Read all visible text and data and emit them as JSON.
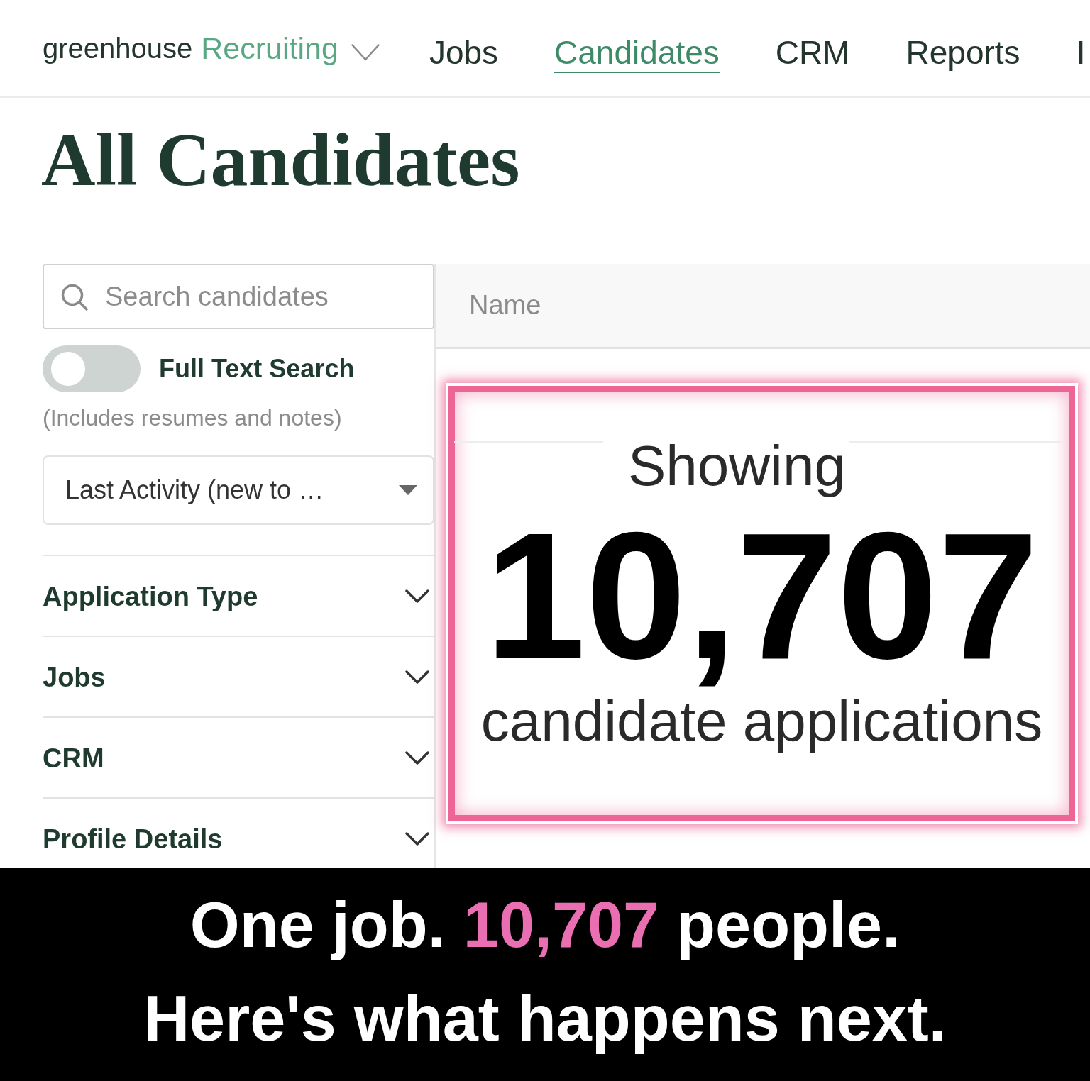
{
  "header": {
    "logo": {
      "brand": "greenhouse",
      "product": "Recruiting"
    },
    "nav": [
      {
        "label": "Jobs",
        "selected": false
      },
      {
        "label": "Candidates",
        "selected": true
      },
      {
        "label": "CRM",
        "selected": false
      },
      {
        "label": "Reports",
        "selected": false
      },
      {
        "label": "I",
        "selected": false
      }
    ]
  },
  "page_title": "All Candidates",
  "sidebar": {
    "search": {
      "placeholder": "Search candidates"
    },
    "full_text_search": {
      "label": "Full Text Search",
      "on": false,
      "hint": "(Includes resumes and notes)"
    },
    "sort": {
      "value": "Last Activity (new to …"
    },
    "filters": [
      {
        "label": "Application Type",
        "expanded": false
      },
      {
        "label": "Jobs",
        "expanded": false
      },
      {
        "label": "CRM",
        "expanded": false
      },
      {
        "label": "Profile Details",
        "expanded": false
      }
    ]
  },
  "table": {
    "columns": [
      "Name"
    ]
  },
  "highlight": {
    "intro": "Showing",
    "count": "10,707",
    "unit": "candidate applications"
  },
  "caption": {
    "lines": [
      {
        "parts": [
          {
            "text": "One job. ",
            "highlighted": false
          },
          {
            "text": "10,707",
            "highlighted": true
          },
          {
            "text": " people.",
            "highlighted": false
          }
        ]
      },
      {
        "parts": [
          {
            "text": "Here's what happens next.",
            "highlighted": false
          }
        ]
      }
    ]
  }
}
